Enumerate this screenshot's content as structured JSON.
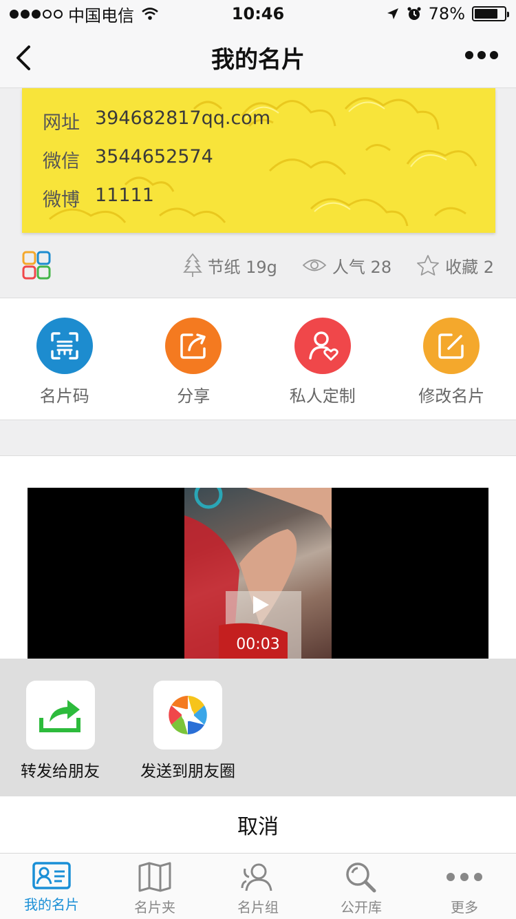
{
  "status_bar": {
    "carrier": "中国电信",
    "time": "10:46",
    "battery": "78%",
    "battery_level": 0.78
  },
  "nav": {
    "title": "我的名片"
  },
  "card": {
    "rows": [
      {
        "label": "网址",
        "value": "394682817qq.com"
      },
      {
        "label": "微信",
        "value": "3544652574"
      },
      {
        "label": "微博",
        "value": "11111"
      }
    ]
  },
  "stats": {
    "paper": "节纸 19g",
    "views": "人气 28",
    "favorites": "收藏 2"
  },
  "actions": [
    {
      "label": "名片码",
      "color": "#1d8ccf",
      "icon": "card-code-icon"
    },
    {
      "label": "分享",
      "color": "#f47a20",
      "icon": "share-icon"
    },
    {
      "label": "私人定制",
      "color": "#f0474a",
      "icon": "person-heart-icon"
    },
    {
      "label": "修改名片",
      "color": "#f4a82c",
      "icon": "edit-icon"
    }
  ],
  "video": {
    "duration": "00:03"
  },
  "share_sheet": {
    "items": [
      {
        "label": "转发给朋友",
        "icon": "forward-icon"
      },
      {
        "label": "发送到朋友圈",
        "icon": "moments-icon"
      }
    ],
    "cancel": "取消"
  },
  "tabs": [
    {
      "label": "我的名片",
      "icon": "id-card-icon",
      "active": true
    },
    {
      "label": "名片夹",
      "icon": "book-icon",
      "active": false
    },
    {
      "label": "名片组",
      "icon": "group-icon",
      "active": false
    },
    {
      "label": "公开库",
      "icon": "search-icon",
      "active": false
    },
    {
      "label": "更多",
      "icon": "more-icon",
      "active": false
    }
  ],
  "colors": {
    "accent": "#1a8fd6",
    "card_yellow": "#f8e43a"
  }
}
